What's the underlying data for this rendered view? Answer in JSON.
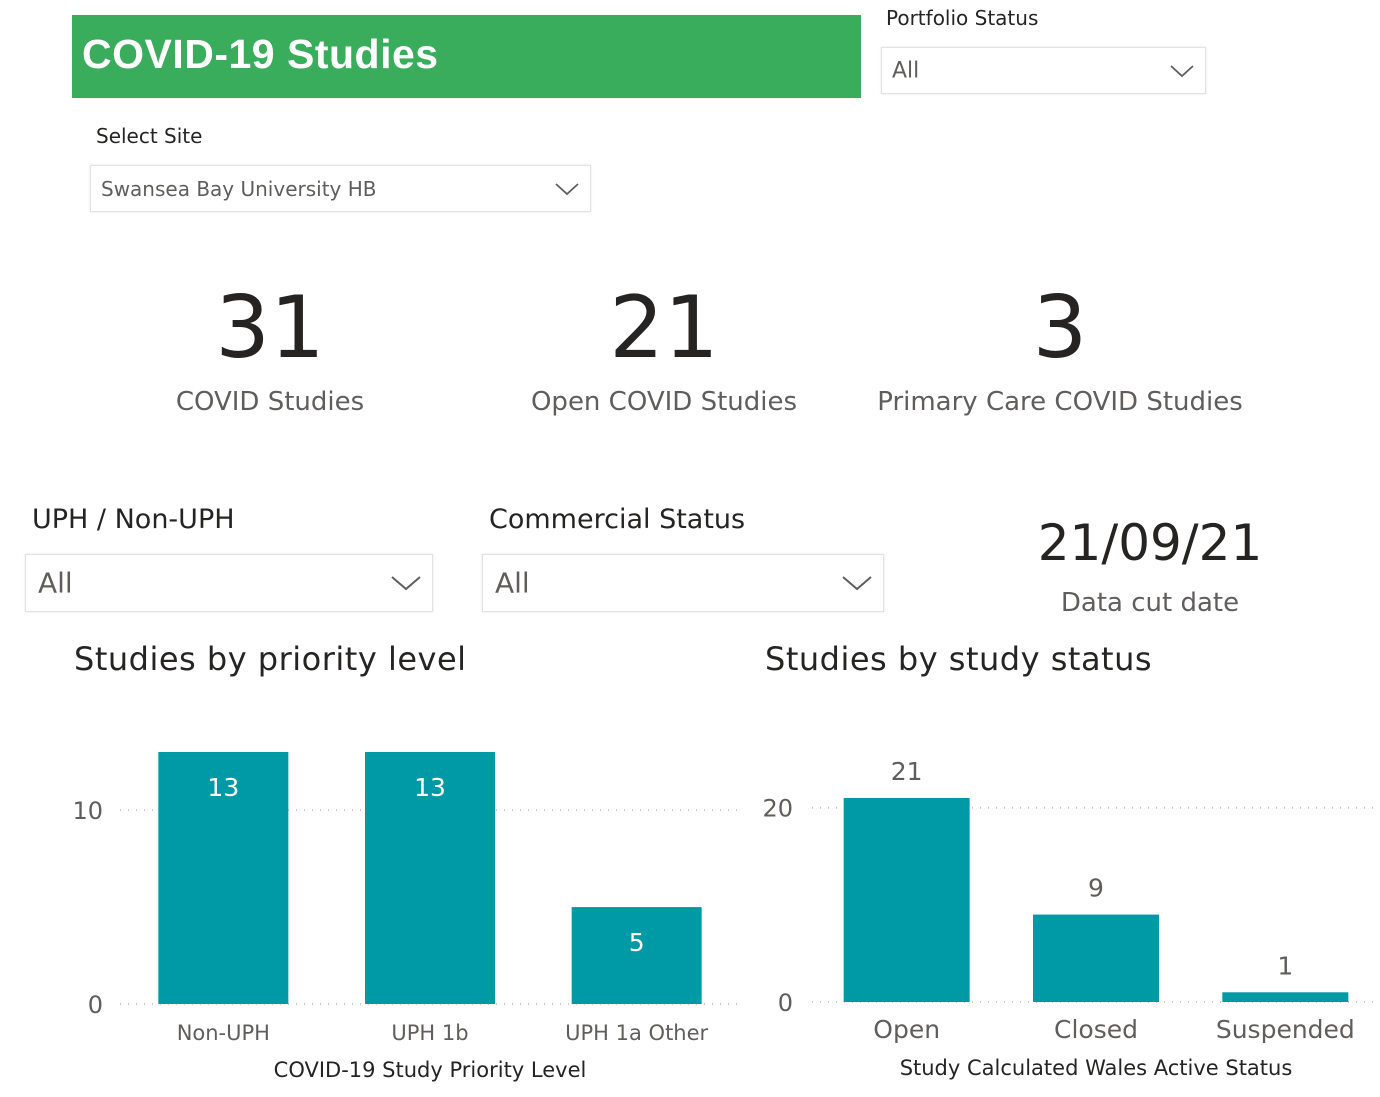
{
  "header": {
    "title": "COVID-19 Studies"
  },
  "portfolio_status": {
    "label": "Portfolio Status",
    "value": "All"
  },
  "select_site": {
    "label": "Select Site",
    "value": "Swansea Bay University HB"
  },
  "kpis": [
    {
      "value": "31",
      "label": "COVID Studies"
    },
    {
      "value": "21",
      "label": "Open COVID Studies"
    },
    {
      "value": "3",
      "label": "Primary Care COVID Studies"
    }
  ],
  "uph_filter": {
    "label": "UPH / Non-UPH",
    "value": "All"
  },
  "commercial_status": {
    "label": "Commercial Status",
    "value": "All"
  },
  "data_cut": {
    "value": "21/09/21",
    "label": "Data cut date"
  },
  "colors": {
    "banner": "#3aad5c",
    "bar": "#009aa6"
  },
  "icons": {
    "dropdown": "chevron-down-icon"
  },
  "chart_data": [
    {
      "type": "bar",
      "title": "Studies by priority level",
      "categories": [
        "Non-UPH",
        "UPH 1b",
        "UPH 1a Other"
      ],
      "values": [
        13,
        13,
        5
      ],
      "xlabel": "COVID-19 Study Priority Level",
      "ylabel": "",
      "yticks": [
        0,
        10
      ],
      "ylim": [
        0,
        13
      ],
      "grid": true,
      "data_labels": true
    },
    {
      "type": "bar",
      "title": "Studies by study status",
      "categories": [
        "Open",
        "Closed",
        "Suspended"
      ],
      "values": [
        21,
        9,
        1
      ],
      "xlabel": "Study Calculated Wales Active Status",
      "ylabel": "",
      "yticks": [
        0,
        20
      ],
      "ylim": [
        0,
        21
      ],
      "grid": true,
      "data_labels": true
    }
  ]
}
